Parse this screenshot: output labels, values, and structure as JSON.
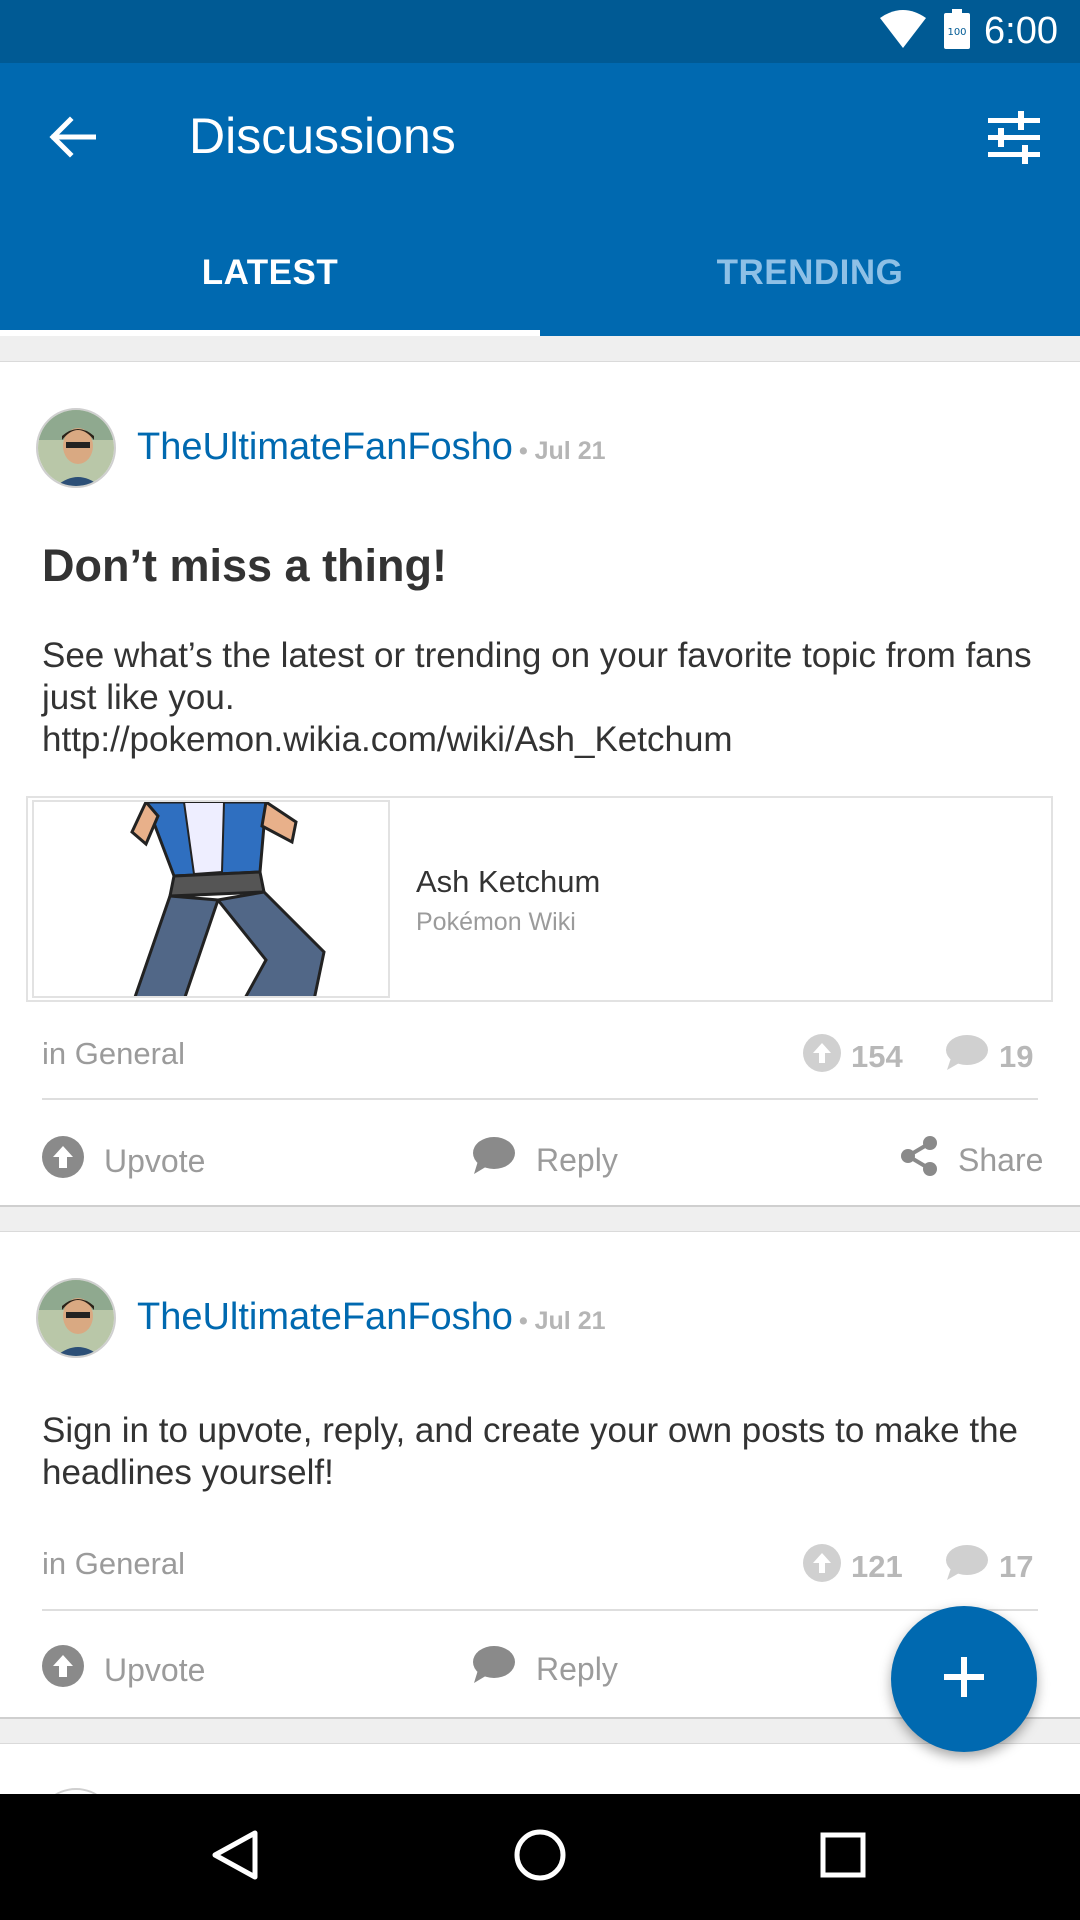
{
  "status_bar": {
    "time": "6:00",
    "battery_level": "100"
  },
  "app_bar": {
    "title": "Discussions"
  },
  "tabs": [
    {
      "label": "LATEST",
      "selected": true
    },
    {
      "label": "TRENDING",
      "selected": false
    }
  ],
  "posts": [
    {
      "author": "TheUltimateFanFosho",
      "date": "• Jul 21",
      "title": "Don’t miss a thing!",
      "body": "See what’s the latest or trending on your favorite topic from fans just like you.",
      "link": "http://pokemon.wikia.com/wiki/Ash_Ketchum",
      "preview": {
        "title": "Ash Ketchum",
        "site": "Pokémon Wiki"
      },
      "category": "in General",
      "upvotes": "154",
      "replies": "19",
      "actions": {
        "upvote": "Upvote",
        "reply": "Reply",
        "share": "Share"
      }
    },
    {
      "author": "TheUltimateFanFosho",
      "date": "• Jul 21",
      "body": "Sign in to upvote, reply, and create your own posts to make the headlines yourself!",
      "category": "in General",
      "upvotes": "121",
      "replies": "17",
      "actions": {
        "upvote": "Upvote",
        "reply": "Reply"
      }
    }
  ],
  "colors": {
    "primary": "#0069b0",
    "status_bar": "#005a94",
    "muted_text": "#9b9b9b"
  },
  "icons": [
    "wifi-icon",
    "battery-icon",
    "back-arrow-icon",
    "filter-icon",
    "upvote-icon",
    "comment-icon",
    "share-icon",
    "plus-icon",
    "nav-back-icon",
    "nav-home-icon",
    "nav-recents-icon"
  ]
}
